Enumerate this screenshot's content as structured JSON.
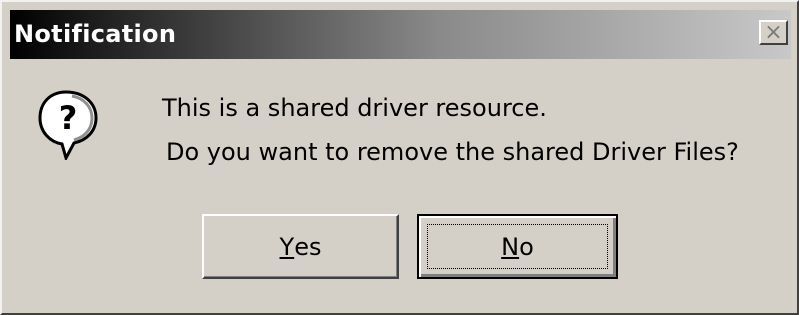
{
  "window": {
    "title": "Notification",
    "close_glyph": "×"
  },
  "icon": "question-icon",
  "message": {
    "line1": "This is a shared driver resource.",
    "line2": "Do you want to remove the shared Driver Files?"
  },
  "buttons": {
    "yes": {
      "mnemonic": "Y",
      "rest": "es"
    },
    "no": {
      "mnemonic": "N",
      "rest": "o"
    }
  }
}
